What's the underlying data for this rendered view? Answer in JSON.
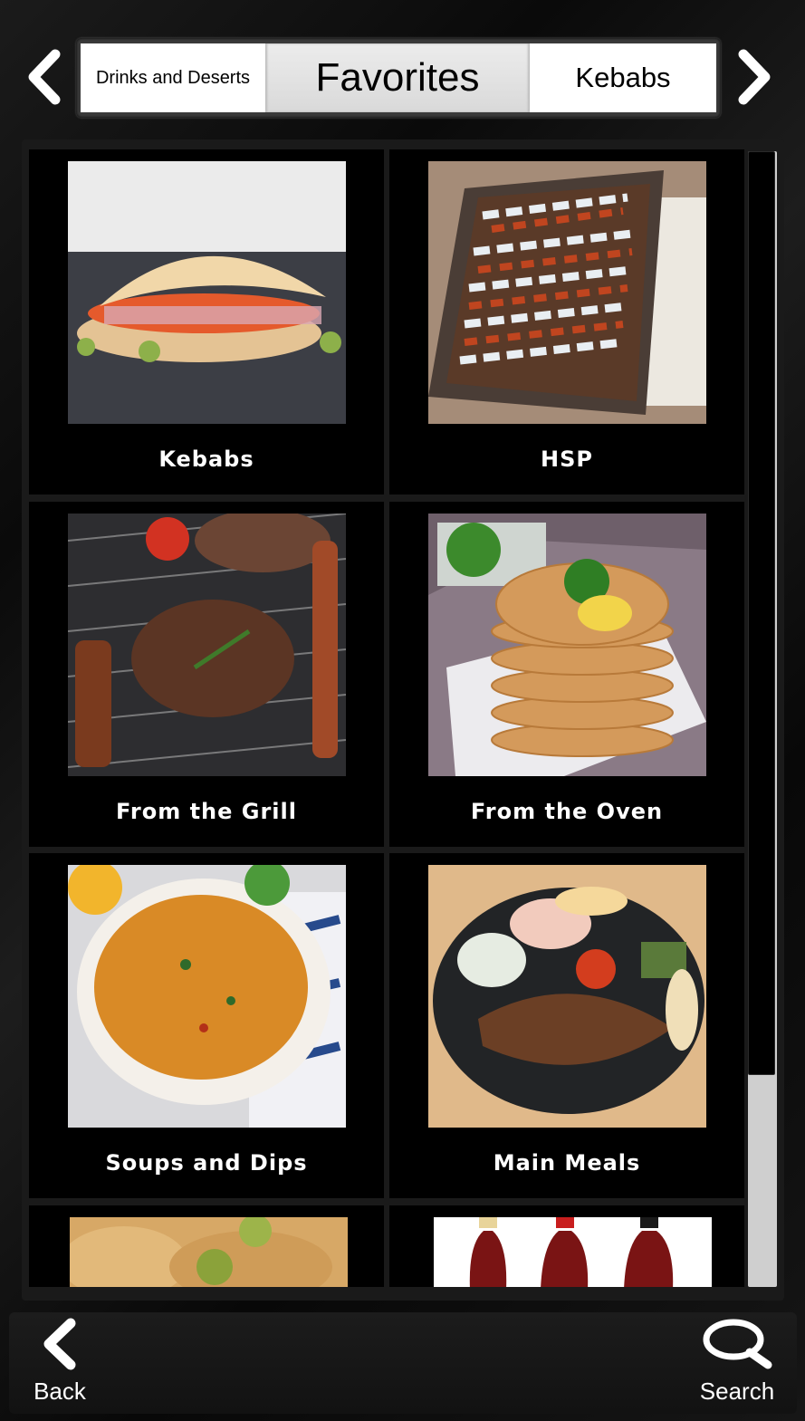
{
  "header": {
    "tabs": {
      "previous": "Drinks and Deserts",
      "current": "Favorites",
      "next": "Kebabs"
    },
    "icons": {
      "left": "chevron-left-icon",
      "right": "chevron-right-icon"
    }
  },
  "grid": {
    "items": [
      {
        "label": "Kebabs"
      },
      {
        "label": "HSP"
      },
      {
        "label": "From the Grill"
      },
      {
        "label": "From the Oven"
      },
      {
        "label": "Soups and Dips"
      },
      {
        "label": "Main Meals"
      }
    ],
    "partial_items": [
      "baklava-dessert",
      "cola-bottles"
    ]
  },
  "footer": {
    "back_label": "Back",
    "search_label": "Search",
    "icons": {
      "back": "chevron-left-icon",
      "search": "search-icon"
    }
  },
  "colors": {
    "background": "#0a0a0a",
    "card": "#000000",
    "tab_active": "#dcdcdc",
    "text_light": "#ffffff"
  }
}
